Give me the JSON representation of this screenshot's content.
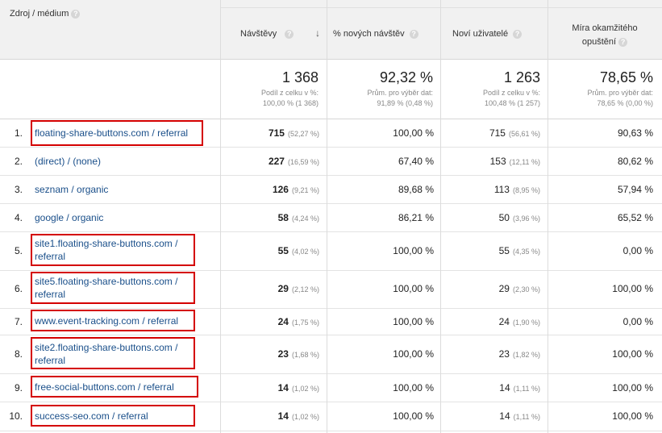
{
  "header": {
    "dimension_label": "Zdroj / médium",
    "col_visits": "Návštěvy",
    "col_new_visits": "% nových návštěv",
    "col_new_users": "Noví uživatelé",
    "col_bounce_line1": "Míra okamžitého",
    "col_bounce_line2": "opuštění",
    "help_glyph": "?"
  },
  "totals": {
    "visits": "1 368",
    "visits_sub1": "Podíl z celku v %:",
    "visits_sub2": "100,00 % (1 368)",
    "new_visits": "92,32 %",
    "new_visits_sub1": "Prům. pro výběr dat:",
    "new_visits_sub2": "91,89 % (0,48 %)",
    "new_users": "1 263",
    "new_users_sub1": "Podíl z celku v %:",
    "new_users_sub2": "100,48 % (1 257)",
    "bounce": "78,65 %",
    "bounce_sub1": "Prům. pro výběr dat:",
    "bounce_sub2": "78,65 % (0,00 %)"
  },
  "rows": [
    {
      "num": "1.",
      "src1": "floating-share-buttons.com / referral",
      "src2": "",
      "visits": "715",
      "visits_pct": "(52,27 %)",
      "new_visits": "100,00 %",
      "new_users": "715",
      "new_users_pct": "(56,61 %)",
      "bounce": "90,63 %",
      "highlight": true
    },
    {
      "num": "2.",
      "src1": "(direct) / (none)",
      "src2": "",
      "visits": "227",
      "visits_pct": "(16,59 %)",
      "new_visits": "67,40 %",
      "new_users": "153",
      "new_users_pct": "(12,11 %)",
      "bounce": "80,62 %",
      "highlight": false
    },
    {
      "num": "3.",
      "src1": "seznam / organic",
      "src2": "",
      "visits": "126",
      "visits_pct": "(9,21 %)",
      "new_visits": "89,68 %",
      "new_users": "113",
      "new_users_pct": "(8,95 %)",
      "bounce": "57,94 %",
      "highlight": false
    },
    {
      "num": "4.",
      "src1": "google / organic",
      "src2": "",
      "visits": "58",
      "visits_pct": "(4,24 %)",
      "new_visits": "86,21 %",
      "new_users": "50",
      "new_users_pct": "(3,96 %)",
      "bounce": "65,52 %",
      "highlight": false
    },
    {
      "num": "5.",
      "src1": "site1.floating-share-buttons.com /",
      "src2": "referral",
      "visits": "55",
      "visits_pct": "(4,02 %)",
      "new_visits": "100,00 %",
      "new_users": "55",
      "new_users_pct": "(4,35 %)",
      "bounce": "0,00 %",
      "highlight": true
    },
    {
      "num": "6.",
      "src1": "site5.floating-share-buttons.com /",
      "src2": "referral",
      "visits": "29",
      "visits_pct": "(2,12 %)",
      "new_visits": "100,00 %",
      "new_users": "29",
      "new_users_pct": "(2,30 %)",
      "bounce": "100,00 %",
      "highlight": true
    },
    {
      "num": "7.",
      "src1": "www.event-tracking.com / referral",
      "src2": "",
      "visits": "24",
      "visits_pct": "(1,75 %)",
      "new_visits": "100,00 %",
      "new_users": "24",
      "new_users_pct": "(1,90 %)",
      "bounce": "0,00 %",
      "highlight": true
    },
    {
      "num": "8.",
      "src1": "site2.floating-share-buttons.com /",
      "src2": "referral",
      "visits": "23",
      "visits_pct": "(1,68 %)",
      "new_visits": "100,00 %",
      "new_users": "23",
      "new_users_pct": "(1,82 %)",
      "bounce": "100,00 %",
      "highlight": true
    },
    {
      "num": "9.",
      "src1": "free-social-buttons.com / referral",
      "src2": "",
      "visits": "14",
      "visits_pct": "(1,02 %)",
      "new_visits": "100,00 %",
      "new_users": "14",
      "new_users_pct": "(1,11 %)",
      "bounce": "100,00 %",
      "highlight": true
    },
    {
      "num": "10.",
      "src1": "success-seo.com / referral",
      "src2": "",
      "visits": "14",
      "visits_pct": "(1,02 %)",
      "new_visits": "100,00 %",
      "new_users": "14",
      "new_users_pct": "(1,11 %)",
      "bounce": "100,00 %",
      "highlight": true
    }
  ],
  "colors": {
    "link": "#1a4f8a",
    "highlight_border": "#d40000",
    "header_bg": "#f1f1f1"
  }
}
